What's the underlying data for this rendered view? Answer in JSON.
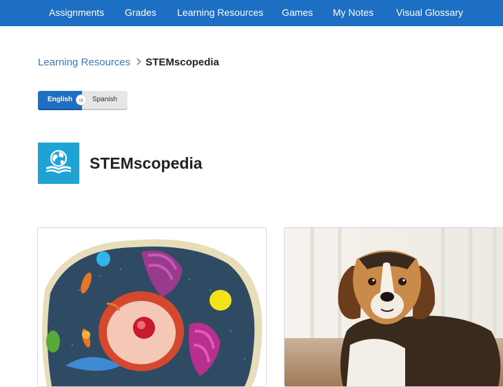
{
  "nav": {
    "items": [
      "Assignments",
      "Grades",
      "Learning Resources",
      "Games",
      "My Notes",
      "Visual Glossary"
    ]
  },
  "breadcrumb": {
    "parent": "Learning Resources",
    "current": "STEMscopedia"
  },
  "language_toggle": {
    "english": "English",
    "or": "or",
    "spanish": "Spanish",
    "selected": "English"
  },
  "page": {
    "title": "STEMscopedia",
    "icon": "globe-book-icon"
  },
  "cards": [
    {
      "image": "animal-cell-image"
    },
    {
      "image": "beagle-dog-image"
    }
  ],
  "colors": {
    "nav_bg": "#1d6fc4",
    "accent": "#1d6fc4",
    "title_icon_bg": "#1fa3d4",
    "link": "#3b78b8"
  }
}
